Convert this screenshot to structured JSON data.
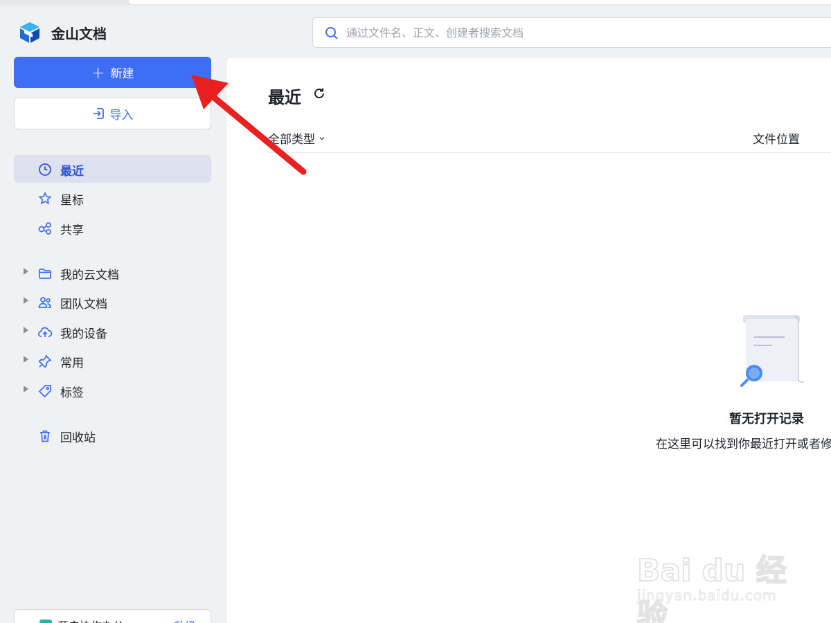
{
  "app": {
    "name": "金山文档"
  },
  "sidebar": {
    "new_label": "新建",
    "import_label": "导入",
    "items": [
      {
        "label": "最近",
        "icon": "clock-icon",
        "active": true
      },
      {
        "label": "星标",
        "icon": "star-icon"
      },
      {
        "label": "共享",
        "icon": "share-icon"
      },
      {
        "label": "我的云文档",
        "icon": "folder-icon",
        "expandable": true
      },
      {
        "label": "团队文档",
        "icon": "team-icon",
        "expandable": true
      },
      {
        "label": "我的设备",
        "icon": "cloud-upload-icon",
        "expandable": true
      },
      {
        "label": "常用",
        "icon": "pin-icon",
        "expandable": true
      },
      {
        "label": "标签",
        "icon": "tag-icon",
        "expandable": true
      },
      {
        "label": "回收站",
        "icon": "trash-icon"
      }
    ],
    "promo_text": "开启协作办公",
    "promo_action": "升级"
  },
  "search": {
    "placeholder": "通过文件名、正文、创建者搜索文档",
    "value": ""
  },
  "main": {
    "title": "最近",
    "filter_label": "全部类型",
    "location_header": "文件位置",
    "empty_title": "暂无打开记录",
    "empty_desc": "在这里可以找到你最近打开或者修"
  },
  "watermark": {
    "brand": "Bai du 经验",
    "url": "jingyan.baidu.com"
  },
  "colors": {
    "accent": "#3d6ef5",
    "active_bg": "#dde1ef",
    "annotation": "#e8201f"
  }
}
